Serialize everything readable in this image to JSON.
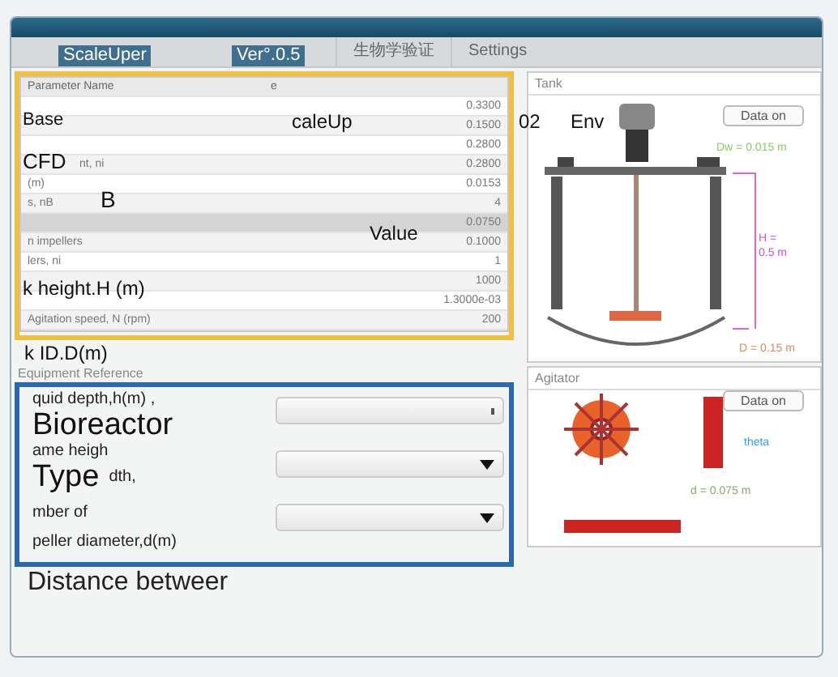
{
  "tabs": [
    {
      "label": "生物学验证",
      "selected": false
    },
    {
      "label": "Settings",
      "selected": false
    }
  ],
  "table": {
    "columns": [
      "Parameter Name",
      "e"
    ],
    "rows": [
      {
        "value": "0.3300",
        "selected": false
      },
      {
        "value": "0.1500",
        "selected": false
      },
      {
        "value": "0.2800",
        "selected": false
      },
      {
        "name": "nt, ni",
        "value": "0.2800",
        "selected": false
      },
      {
        "name": "(m)",
        "value": "0.0153",
        "selected": false
      },
      {
        "name": "s, nB",
        "value": "4",
        "selected": false
      },
      {
        "value": "0.0750",
        "selected": true
      },
      {
        "name": "n impellers",
        "value": "0.1000",
        "selected": false
      },
      {
        "name": "lers, ni",
        "value": "1",
        "selected": false
      },
      {
        "value": "1000",
        "selected": false
      },
      {
        "value": "1.3000e-03",
        "selected": false
      },
      {
        "name": "Agitation speed, N (rpm)",
        "value": "200",
        "selected": false
      }
    ]
  },
  "equipment": {
    "title": "Equipment Reference",
    "labels": [
      "quid depth,h(m) ,",
      "ame heigh",
      "dth,",
      "mber of",
      "peller diameter,d(m)",
      "Distance betweer"
    ],
    "dropdowns": [
      {
        "kind": "plain"
      },
      {
        "kind": "arrow"
      },
      {
        "kind": "arrow"
      }
    ]
  },
  "tank": {
    "title": "Tank",
    "button": "Data on",
    "dw": "Dw = 0.015 m",
    "h": "H =\n0.5 m",
    "d": "D = 0.15 m"
  },
  "agitator": {
    "title": "Agitator",
    "button": "Data on",
    "theta": "theta",
    "d": "d = 0.075 m"
  },
  "overlays": [
    "ScaleUper",
    "Ver°.0.5",
    "Base",
    "caleUp",
    "02",
    "Env",
    "CFD",
    "B",
    "Value",
    "k   height.H    (m)",
    "k     ID.D(m)",
    "Bioreactor",
    "Type"
  ]
}
